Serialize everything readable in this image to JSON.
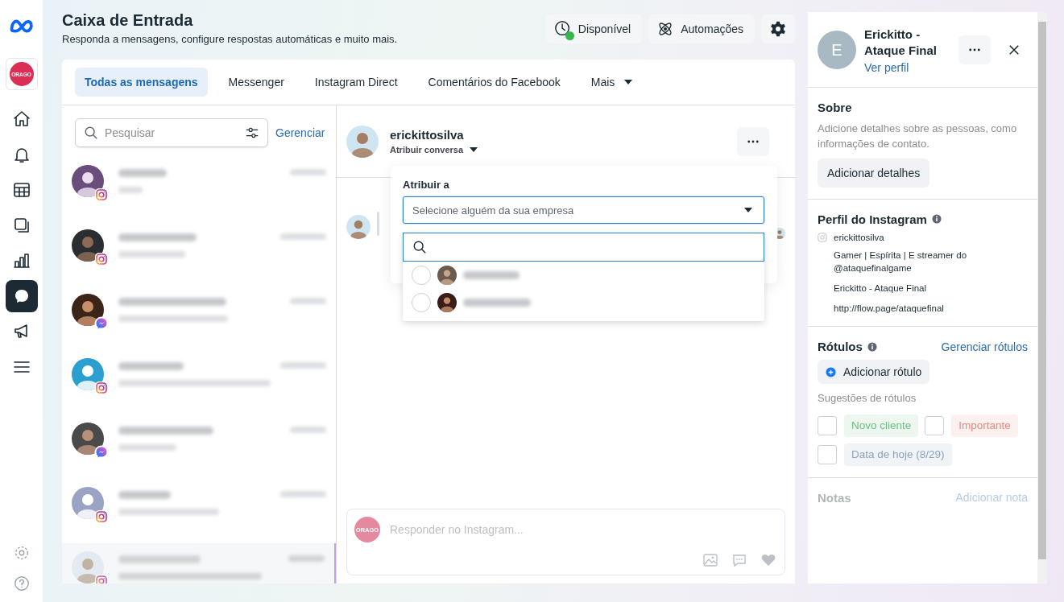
{
  "sidebar": {
    "logo": "ORAGO",
    "nav": [
      {
        "kind": "home",
        "selected": false
      },
      {
        "kind": "bell",
        "selected": false
      },
      {
        "kind": "table",
        "selected": false
      },
      {
        "kind": "pages",
        "selected": false
      },
      {
        "kind": "chart",
        "selected": false
      },
      {
        "kind": "chat",
        "selected": true
      },
      {
        "kind": "megaphone",
        "selected": false
      },
      {
        "kind": "menu",
        "selected": false
      }
    ]
  },
  "header": {
    "title": "Caixa de Entrada",
    "subtitle": "Responda a mensagens, configure respostas automáticas e muito mais.",
    "buttons": [
      {
        "kind": "status",
        "label": "Disponível"
      },
      {
        "kind": "automation",
        "label": "Automações"
      },
      {
        "kind": "settings"
      }
    ]
  },
  "tabs": [
    {
      "label": "Todas as mensagens",
      "selected": true,
      "has_menu": false
    },
    {
      "label": "Messenger",
      "selected": false,
      "has_menu": false
    },
    {
      "label": "Instagram Direct",
      "selected": false,
      "has_menu": false
    },
    {
      "label": "Comentários do Facebook",
      "selected": false,
      "has_menu": false
    },
    {
      "label": "Mais",
      "selected": false,
      "has_menu": true
    }
  ],
  "conversation_list": {
    "search_placeholder": "Pesquisar",
    "manage_link": "Gerenciar",
    "items": [
      {
        "kind": "instagram",
        "selected": false
      },
      {
        "kind": "instagram",
        "selected": false
      },
      {
        "kind": "messenger",
        "selected": false
      },
      {
        "kind": "instagram",
        "selected": false
      },
      {
        "kind": "messenger",
        "selected": false
      },
      {
        "kind": "instagram",
        "selected": false
      },
      {
        "kind": "instagram",
        "selected": true
      }
    ]
  },
  "chat": {
    "contact": "erickittosilva",
    "assign_label": "Atribuir conversa",
    "assign_menu": {
      "title": "Atribuir a",
      "select_placeholder": "Selecione alguém da sua empresa",
      "options": [
        {
          "selected": false
        },
        {
          "selected": false
        }
      ]
    },
    "composer": {
      "avatar": "ORAGO",
      "placeholder": "Responder no Instagram..."
    }
  },
  "details": {
    "avatar_letter": "E",
    "name": "Erickitto - Ataque Final",
    "profile_link": "Ver perfil",
    "about": {
      "title": "Sobre",
      "text": "Adicione detalhes sobre as pessoas, como informações de contato.",
      "button": "Adicionar detalhes"
    },
    "instagram": {
      "title": "Perfil do Instagram",
      "username": "erickittosilva",
      "lines": [
        "Gamer | Espírita | E streamer do @ataquefinalgame",
        "Erickitto - Ataque Final",
        "http://flow.page/ataquefinal"
      ]
    },
    "labels": {
      "title": "Rótulos",
      "manage": "Gerenciar rótulos",
      "add": "Adicionar rótulo",
      "suggestions_title": "Sugestões de rótulos",
      "suggestions": [
        {
          "label": "Novo cliente",
          "color": "#6dbf80",
          "checked": false
        },
        {
          "label": "Importante",
          "color": "#e8897f",
          "checked": false
        },
        {
          "label": "Data de hoje (8/29)",
          "color": "#8ea3ba",
          "checked": false
        }
      ]
    },
    "notes": {
      "title": "Notas",
      "add": "Adicionar nota"
    }
  }
}
